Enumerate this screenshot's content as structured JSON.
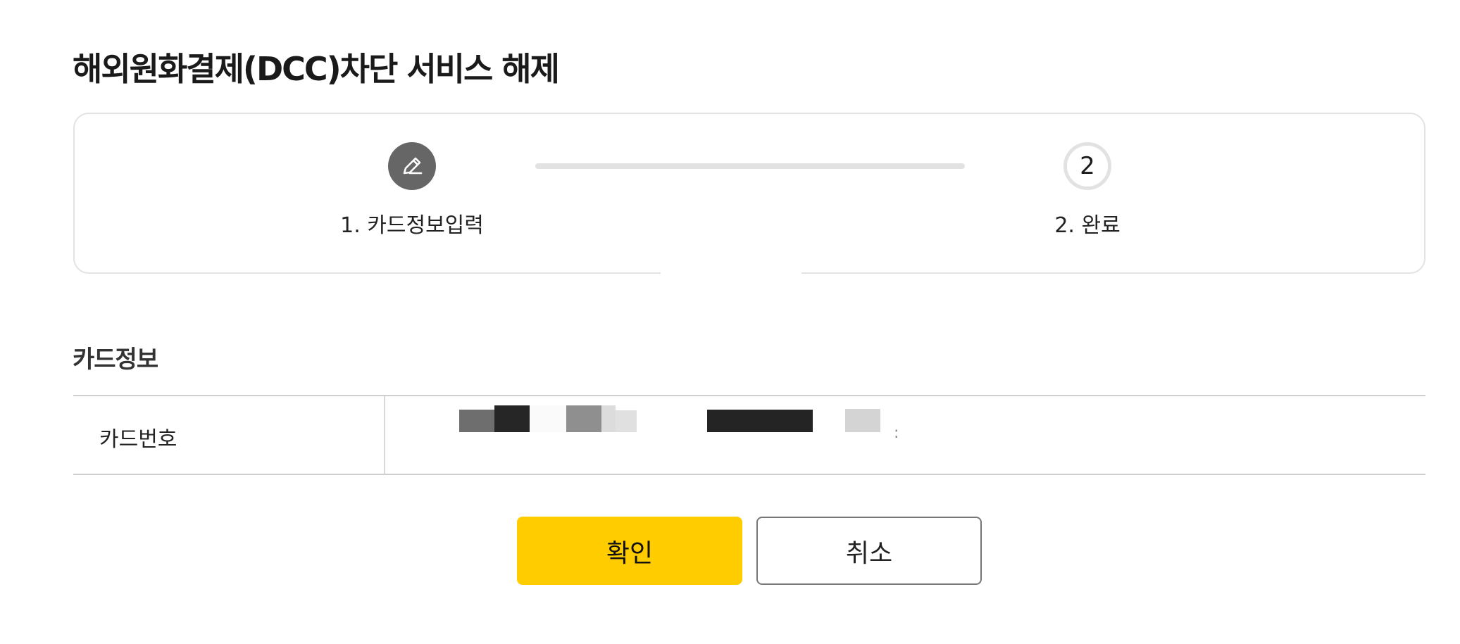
{
  "page": {
    "title": "해외원화결제(DCC)차단 서비스 해제"
  },
  "stepper": {
    "steps": [
      {
        "label": "1. 카드정보입력",
        "icon": "pencil-icon",
        "state": "current"
      },
      {
        "label": "2. 완료",
        "number": "2",
        "state": "upcoming"
      }
    ]
  },
  "card_info": {
    "section_title": "카드정보",
    "card_number_label": "카드번호",
    "card_number_value": ":"
  },
  "buttons": {
    "confirm_label": "확인",
    "cancel_label": "취소"
  },
  "colors": {
    "accent": "#ffcc00",
    "step_active": "#666666",
    "step_inactive": "#e2e2e2"
  }
}
